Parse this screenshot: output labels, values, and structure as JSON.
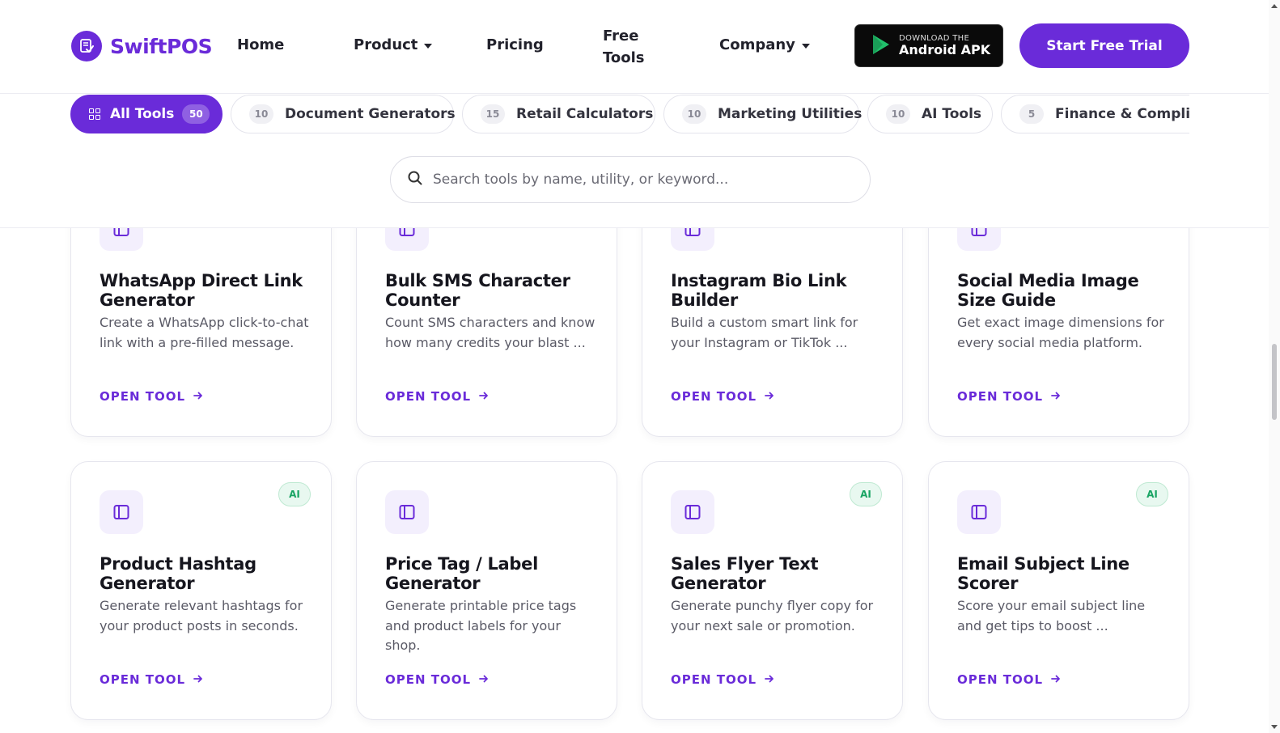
{
  "brand": {
    "name": "SwiftPOS",
    "accent": "#6a2bd9",
    "logo_icon": "document-check-icon"
  },
  "nav": {
    "home": "Home",
    "product": "Product",
    "pricing": "Pricing",
    "free_tools": "Free Tools",
    "company": "Company"
  },
  "apk": {
    "small": "DOWNLOAD THE",
    "big": "Android APK",
    "icon": "play-store-icon"
  },
  "cta": {
    "label": "Start Free Trial"
  },
  "filters": [
    {
      "label": "All Tools",
      "count": "50",
      "active": true
    },
    {
      "label": "Document Generators",
      "count": "10",
      "active": false
    },
    {
      "label": "Retail Calculators",
      "count": "15",
      "active": false
    },
    {
      "label": "Marketing Utilities",
      "count": "10",
      "active": false
    },
    {
      "label": "AI Tools",
      "count": "10",
      "active": false
    },
    {
      "label": "Finance & Compliance",
      "count": "5",
      "active": false
    }
  ],
  "search": {
    "placeholder": "Search tools by name, utility, or keyword..."
  },
  "cards": [
    {
      "title": "WhatsApp Direct Link Generator",
      "desc": "Create a WhatsApp click-to-chat link with a pre-filled message.",
      "badge": "",
      "link": "OPEN TOOL"
    },
    {
      "title": "Bulk SMS Character Counter",
      "desc": "Count SMS characters and know how many credits your blast ...",
      "badge": "",
      "link": "OPEN TOOL"
    },
    {
      "title": "Instagram Bio Link Builder",
      "desc": "Build a custom smart link for your Instagram or TikTok ...",
      "badge": "",
      "link": "OPEN TOOL"
    },
    {
      "title": "Social Media Image Size Guide",
      "desc": "Get exact image dimensions for every social media platform.",
      "badge": "",
      "link": "OPEN TOOL"
    },
    {
      "title": "Product Hashtag Generator",
      "desc": "Generate relevant hashtags for your product posts in seconds.",
      "badge": "AI",
      "link": "OPEN TOOL"
    },
    {
      "title": "Price Tag / Label Generator",
      "desc": "Generate printable price tags and product labels for your shop.",
      "badge": "",
      "link": "OPEN TOOL"
    },
    {
      "title": "Sales Flyer Text Generator",
      "desc": "Generate punchy flyer copy for your next sale or promotion.",
      "badge": "AI",
      "link": "OPEN TOOL"
    },
    {
      "title": "Email Subject Line Scorer",
      "desc": "Score your email subject line and get tips to boost ...",
      "badge": "AI",
      "link": "OPEN TOOL"
    }
  ]
}
